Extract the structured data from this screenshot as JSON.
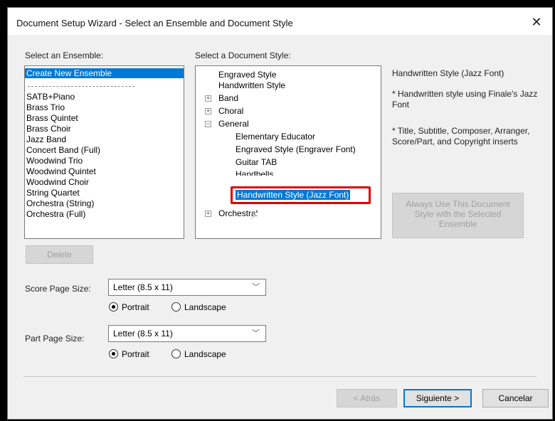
{
  "window": {
    "title": "Document Setup Wizard - Select an Ensemble and Document Style",
    "close_glyph": "✕"
  },
  "ensemble": {
    "label": "Select an Ensemble:",
    "items": [
      "Create New Ensemble",
      "SATB+Piano",
      "Brass Trio",
      "Brass Quintet",
      "Brass Choir",
      "Jazz Band",
      "Concert Band (Full)",
      "Woodwind Trio",
      "Woodwind Quintet",
      "Woodwind Choir",
      "String Quartet",
      "Orchestra (String)",
      "Orchestra (Full)"
    ],
    "delete_label": "Delete"
  },
  "style": {
    "label": "Select a Document Style:",
    "tree": [
      {
        "label": "Engraved Style"
      },
      {
        "label": "Handwritten Style"
      },
      {
        "label": "Band",
        "expander": "+"
      },
      {
        "label": "Choral",
        "expander": "+"
      },
      {
        "label": "General",
        "expander": "−"
      },
      {
        "label": "Elementary Educator"
      },
      {
        "label": "Engraved Style (Engraver Font)"
      },
      {
        "label": "Guitar TAB"
      },
      {
        "label": "Handbells"
      },
      {
        "label": "Handwritten Style (Jazz Font)",
        "selected": true
      },
      {
        "label": "Orchestral",
        "expander": "+"
      }
    ]
  },
  "description": {
    "title": "Handwritten Style (Jazz Font)",
    "line1": "* Handwritten style using Finale's Jazz Font",
    "line2": "* Title, Subtitle, Composer, Arranger, Score/Part, and Copyright inserts",
    "always_use_label": "Always Use This Document Style with the Selected Ensemble"
  },
  "score": {
    "label": "Score Page Size:",
    "value": "Letter (8.5 x 11)",
    "portrait": "Portrait",
    "landscape": "Landscape"
  },
  "part": {
    "label": "Part Page Size:",
    "value": "Letter (8.5 x 11)",
    "portrait": "Portrait",
    "landscape": "Landscape"
  },
  "footer": {
    "back": "< Atrás",
    "next": "Siguiente >",
    "cancel": "Cancelar"
  },
  "colors": {
    "selection": "#0078d7",
    "highlight": "#e00000"
  }
}
